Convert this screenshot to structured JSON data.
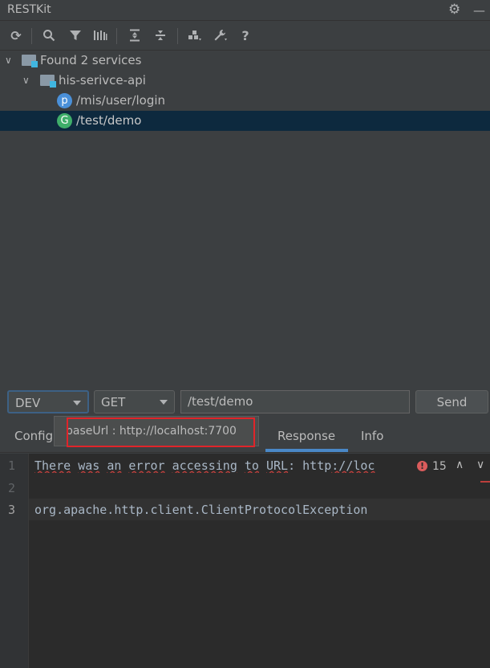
{
  "window": {
    "title": "RESTKit"
  },
  "tree": {
    "root": "Found 2 services",
    "module": "his-serivce-api",
    "endpoints": [
      {
        "badge": "p",
        "path": "/mis/user/login",
        "color": "#4a90d9"
      },
      {
        "badge": "G",
        "path": "/test/demo",
        "color": "#3fae6a"
      }
    ]
  },
  "request": {
    "env": "DEV",
    "method": "GET",
    "url": "/test/demo",
    "send_label": "Send"
  },
  "tabs": {
    "config": "Config",
    "response": "Response",
    "info": "Info"
  },
  "tooltip": {
    "text": "baseUrl : http://localhost:7700"
  },
  "editor": {
    "line_numbers": [
      "1",
      "2",
      "3"
    ],
    "line1": {
      "w1": "There",
      "w2": "was",
      "w3": "an",
      "w4": "error",
      "w5": "accessing",
      "w6": "to",
      "w7": "URL",
      "colon": ":",
      "proto": "http",
      "rest": "://loc"
    },
    "line3": "org.apache.http.client.ClientProtocolException",
    "error_count": "15",
    "error_icon": "!"
  }
}
